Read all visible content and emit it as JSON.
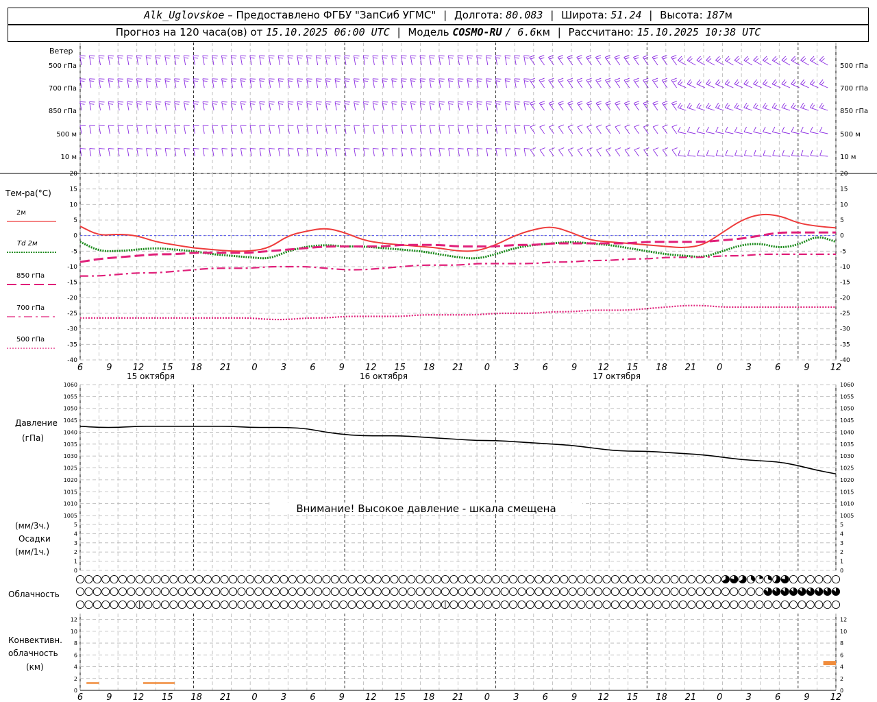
{
  "header": {
    "station": "Alk_Uglovskoe",
    "provider": "– Предоставлено ФГБУ \"ЗапСиб УГМС\"",
    "lon_label": "Долгота:",
    "lon": "80.083",
    "lat_label": "Широта:",
    "lat": "51.24",
    "alt_label": "Высота:",
    "alt": "187",
    "alt_unit": "м",
    "forecast_label": "Прогноз на 120 часа(ов) от",
    "start": "15.10.2025 06:00 UTC",
    "model_label": "Модель",
    "model": "COSMO-RU",
    "resolution": "/ 6.6",
    "res_unit": "км",
    "calc_label": "Рассчитано:",
    "calc": "15.10.2025 10:38 UTC"
  },
  "time_axis": {
    "ticks": [
      "6",
      "9",
      "12",
      "15",
      "18",
      "21",
      "0",
      "3",
      "6",
      "9",
      "12",
      "15",
      "18",
      "21",
      "0",
      "3",
      "6",
      "9",
      "12",
      "15",
      "18",
      "21",
      "0",
      "3",
      "6",
      "9",
      "12"
    ],
    "days": [
      "15 октября",
      "16 октября",
      "17 октября"
    ]
  },
  "colors": {
    "wind": "#8a2be2",
    "t2m": "#ee3b3b",
    "td2m": "#1a8a1a",
    "t850": "#e0207a",
    "t700": "#e0207a",
    "t500": "#e0207a",
    "pressure": "#000000",
    "zero_line": "#3b3bee",
    "convective": "#f08c3c"
  },
  "wind_panel": {
    "title": "Ветер",
    "levels": [
      "500 гПа",
      "700 гПа",
      "850 гПа",
      "500 м",
      "10 м"
    ]
  },
  "temp_panel": {
    "title": "Тем-ра(°C)",
    "legend": [
      "2м",
      "Td 2м",
      "850 гПа",
      "700 гПа",
      "500 гПа"
    ],
    "yticks": [
      "20",
      "15",
      "10",
      "5",
      "0",
      "-5",
      "-10",
      "-15",
      "-20",
      "-25",
      "-30",
      "-35",
      "-40"
    ]
  },
  "pressure_panel": {
    "title": "Давление",
    "unit": "(гПа)",
    "warning": "Внимание! Высокое давление - шкала смещена",
    "yticks": [
      "1060",
      "1055",
      "1050",
      "1045",
      "1040",
      "1035",
      "1030",
      "1025",
      "1020",
      "1015",
      "1010",
      "1005"
    ]
  },
  "precip_panel": {
    "unit3": "(мм/3ч.)",
    "title": "Осадки",
    "unit1": "(мм/1ч.)",
    "yticks": [
      "5",
      "4",
      "3",
      "2",
      "1",
      "0"
    ]
  },
  "cloud_panel": {
    "title": "Облачность"
  },
  "conv_panel": {
    "title1": "Конвективн.",
    "title2": "облачность",
    "unit": "(км)",
    "yticks": [
      "12",
      "10",
      "8",
      "6",
      "4",
      "2",
      "0"
    ]
  },
  "chart_data": [
    {
      "type": "line",
      "name": "temperature",
      "x_hours": [
        0,
        3,
        6,
        9,
        12,
        15,
        18,
        21,
        24,
        27,
        30,
        33,
        36,
        39,
        42,
        45,
        48,
        51,
        54,
        57,
        60,
        63,
        66,
        69,
        72,
        75,
        78,
        81,
        84,
        87,
        90,
        93,
        96,
        99,
        102,
        105,
        108,
        111,
        114,
        117,
        120
      ],
      "ylim": [
        -40,
        20
      ],
      "series": [
        {
          "name": "2м",
          "values": [
            3,
            0,
            0.5,
            0,
            -2,
            -3,
            -4,
            -4.5,
            -5,
            -5,
            -4,
            0,
            1.5,
            2.5,
            1,
            -1.5,
            -2.5,
            -3,
            -3.5,
            -4,
            -5,
            -5,
            -3,
            0,
            2,
            3,
            1,
            -1.5,
            -2,
            -2.5,
            -3,
            -3.5,
            -4,
            -3,
            1,
            5,
            7,
            6.5,
            4,
            3,
            2.5
          ]
        },
        {
          "name": "Td 2м",
          "values": [
            -2,
            -5,
            -5,
            -4.5,
            -4,
            -4.5,
            -5,
            -6,
            -6.5,
            -7,
            -7.5,
            -5,
            -3.5,
            -3,
            -3.5,
            -3.5,
            -4,
            -4.5,
            -5,
            -6,
            -7,
            -7.5,
            -6,
            -4,
            -3,
            -2.5,
            -2,
            -2.5,
            -3,
            -4,
            -5,
            -6,
            -6.5,
            -7,
            -5,
            -3,
            -2.5,
            -4,
            -3,
            0,
            -2
          ]
        },
        {
          "name": "850 гПа",
          "values": [
            -8.5,
            -7.5,
            -7,
            -6.5,
            -6,
            -6,
            -5.5,
            -5.5,
            -5.5,
            -5.5,
            -5,
            -4.5,
            -4,
            -3.5,
            -3.5,
            -3.5,
            -3.5,
            -3,
            -3,
            -3,
            -3.5,
            -3.5,
            -3.5,
            -3,
            -3,
            -2.5,
            -2.5,
            -2.5,
            -2.5,
            -2.5,
            -2,
            -2,
            -2,
            -2,
            -1.5,
            -1,
            0,
            1,
            1,
            1,
            1
          ]
        },
        {
          "name": "700 гПа",
          "values": [
            -13,
            -13,
            -12.5,
            -12,
            -12,
            -11.5,
            -11,
            -10.5,
            -10.5,
            -10.5,
            -10,
            -10,
            -10,
            -10.5,
            -11,
            -11,
            -10.5,
            -10,
            -9.5,
            -9.5,
            -9.5,
            -9,
            -9,
            -9,
            -9,
            -8.5,
            -8.5,
            -8,
            -8,
            -7.5,
            -7.5,
            -7,
            -7,
            -7,
            -6.5,
            -6.5,
            -6,
            -6,
            -6,
            -6,
            -6
          ]
        },
        {
          "name": "500 гПа",
          "values": [
            -26.5,
            -26.5,
            -26.5,
            -26.5,
            -26.5,
            -26.5,
            -26.5,
            -26.5,
            -26.5,
            -26.5,
            -27,
            -27,
            -26.5,
            -26.5,
            -26,
            -26,
            -26,
            -26,
            -25.5,
            -25.5,
            -25.5,
            -25.5,
            -25,
            -25,
            -25,
            -24.5,
            -24.5,
            -24,
            -24,
            -24,
            -23.5,
            -23,
            -22.5,
            -22.5,
            -23,
            -23,
            -23,
            -23,
            -23,
            -23,
            -23
          ]
        }
      ]
    },
    {
      "type": "line",
      "name": "pressure",
      "x_hours": [
        0,
        3,
        6,
        9,
        12,
        15,
        18,
        21,
        24,
        27,
        30,
        33,
        36,
        39,
        42,
        45,
        48,
        51,
        54,
        57,
        60,
        63,
        66,
        69,
        72,
        75,
        78,
        81,
        84,
        87,
        90,
        93,
        96,
        99,
        102,
        105,
        108,
        111,
        114,
        117,
        120
      ],
      "ylim": [
        1005,
        1060
      ],
      "series": [
        {
          "name": "Давление",
          "values": [
            1042.5,
            1042,
            1042,
            1042.5,
            1042.5,
            1042.5,
            1042.5,
            1042.5,
            1042.5,
            1042,
            1042,
            1042,
            1041.5,
            1040,
            1039,
            1038.5,
            1038.5,
            1038.5,
            1038,
            1037.5,
            1037,
            1036.5,
            1036.5,
            1036,
            1035.5,
            1035,
            1034.5,
            1033.5,
            1032.5,
            1032,
            1032,
            1031.5,
            1031,
            1030.5,
            1029.5,
            1028.5,
            1028,
            1027.5,
            1026,
            1024,
            1022.5
          ]
        }
      ]
    },
    {
      "type": "bar",
      "name": "convective_cloud",
      "ylim": [
        0,
        13
      ],
      "segments": [
        {
          "start_h": 1,
          "end_h": 3,
          "value": 1.2
        },
        {
          "start_h": 10,
          "end_h": 15,
          "value": 1.2
        },
        {
          "start_h": 118,
          "end_h": 120,
          "value": 4.8
        }
      ]
    }
  ]
}
